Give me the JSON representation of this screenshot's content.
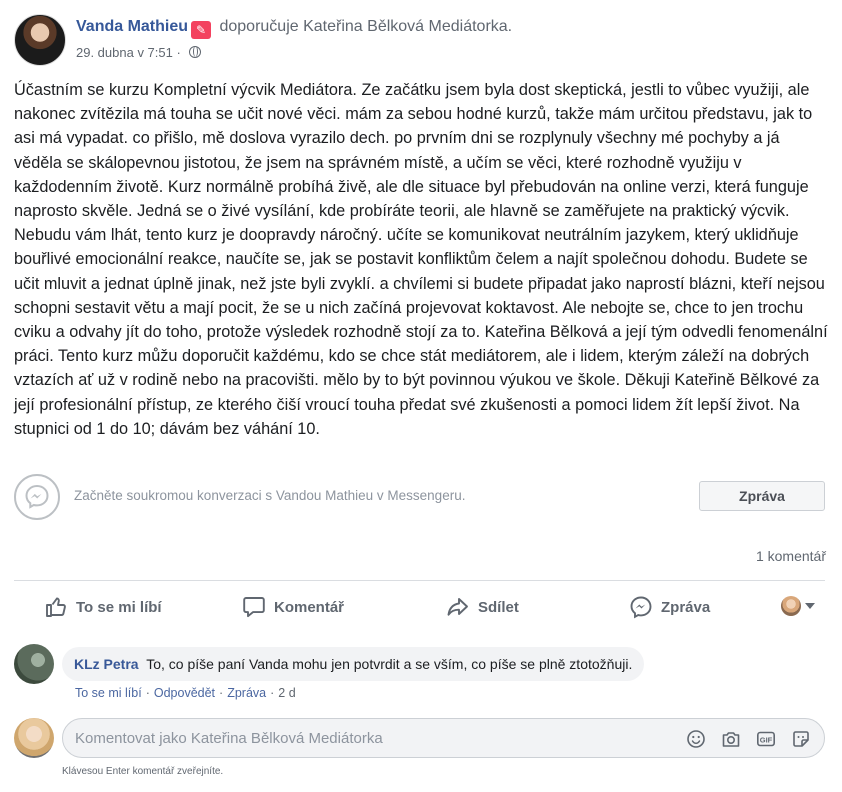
{
  "post": {
    "author": "Vanda Mathieu",
    "recommends_text": "doporučuje",
    "recommended_page": "Kateřina Bělková Mediátorka.",
    "timestamp": "29. dubna v 7:51",
    "audience_icon": "globe-icon",
    "body": "Účastním se kurzu Kompletní výcvik Mediátora. Ze začátku jsem byla dost skeptická, jestli to vůbec využiji, ale nakonec zvítězila má touha se učit nové věci. mám za sebou hodné kurzů, takže mám určitou představu, jak to asi má vypadat. co přišlo, mě doslova vyrazilo dech. po prvním dni se rozplynuly všechny mé pochyby a já věděla se skálopevnou jistotou, že jsem na správném místě, a učím se věci, které rozhodně využiju v každodenním životě. Kurz normálně probíhá živě, ale dle situace byl přebudován na online verzi, která funguje naprosto skvěle. Jedná se o živé vysílání, kde probíráte teorii, ale hlavně se zaměřujete na praktický výcvik. Nebudu vám lhát, tento kurz je doopravdy náročný. učíte se komunikovat neutrálním jazykem, který uklidňuje bouřlivé emocionální reakce, naučíte se, jak se postavit konfliktům čelem a najít společnou dohodu. Budete se učit mluvit a jednat úplně jinak, než jste byli zvyklí. a chvílemi si budete připadat jako naprostí blázni, kteří nejsou schopni sestavit větu a mají pocit, že se u nich začíná projevovat koktavost. Ale nebojte se, chce to jen trochu cviku a odvahy jít do toho, protože výsledek rozhodně stojí za to. Kateřina Bělková a její tým odvedli fenomenální práci. Tento kurz můžu doporučit každému, kdo se chce stát mediátorem, ale i lidem, kterým záleží na dobrých vztazích ať už v rodině nebo na pracovišti. mělo by to být povinnou výukou ve škole. Děkuji Kateřině Bělkové za její profesionální přístup, ze kterého čiší vroucí touha předat své zkušenosti a pomoci lidem žít lepší život. Na stupnici od 1 do 10; dávám bez váhání 10."
  },
  "messenger": {
    "text": "Začněte soukromou konverzaci s Vandou Mathieu v Messengeru.",
    "button": "Zpráva"
  },
  "stats": {
    "comment_count": "1 komentář"
  },
  "actions": {
    "like": "To se mi líbí",
    "comment": "Komentář",
    "share": "Sdílet",
    "message": "Zpráva"
  },
  "comment": {
    "author": "KLz Petra",
    "text": "To, co píše paní Vanda mohu jen potvrdit a se vším, co píše se plně ztotožňuji.",
    "like": "To se mi líbí",
    "reply": "Odpovědět",
    "message": "Zpráva",
    "age": "2 d"
  },
  "composer": {
    "placeholder": "Komentovat jako Kateřina Bělková Mediátorka",
    "hint": "Klávesou Enter komentář zveřejníte."
  },
  "colors": {
    "link_blue": "#365899",
    "secondary_text": "#606770",
    "recommend_badge": "#f3425f"
  }
}
